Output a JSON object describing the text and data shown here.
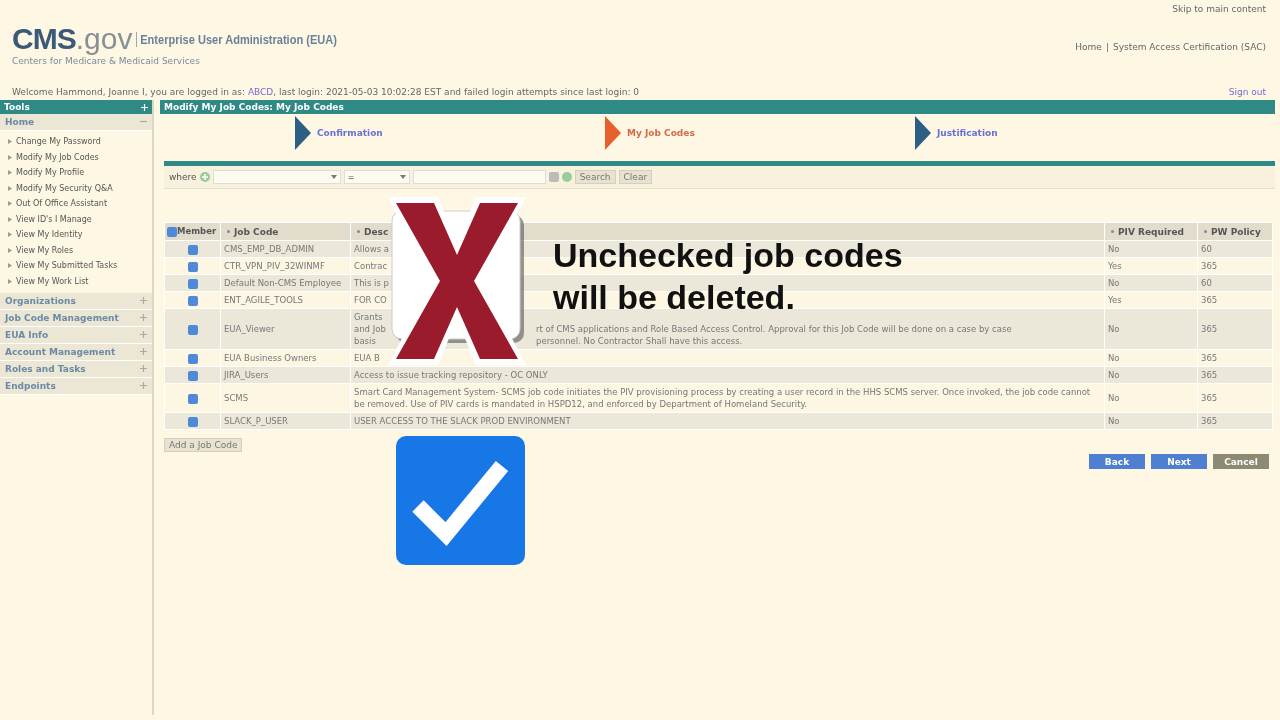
{
  "header": {
    "skip_link": "Skip to main content",
    "logo_main": "CMS",
    "logo_suffix": ".gov",
    "app_title": "Enterprise User Administration (EUA)",
    "subtitle": "Centers for Medicare & Medicaid Services",
    "nav": [
      "Home",
      "|",
      "System Access Certification (SAC)"
    ]
  },
  "welcome": {
    "before": "Welcome Hammond, Joanne I, you are logged in as:",
    "user_id": "ABCD",
    "after": ", last login: 2021-05-03 10:02:28 EST and failed login attempts since last login: 0",
    "sign_out": "Sign out"
  },
  "sidebar": {
    "title": "Tools",
    "sections": [
      {
        "label": "Home",
        "expanded": true,
        "items": [
          "Change My Password",
          "Modify My Job Codes",
          "Modify My Profile",
          "Modify My Security Q&A",
          "Out Of Office Assistant",
          "View ID's I Manage",
          "View My Identity",
          "View My Roles",
          "View My Submitted Tasks",
          "View My Work List"
        ]
      },
      {
        "label": "Organizations",
        "expanded": false
      },
      {
        "label": "Job Code Management",
        "expanded": false
      },
      {
        "label": "EUA Info",
        "expanded": false
      },
      {
        "label": "Account Management",
        "expanded": false
      },
      {
        "label": "Roles and Tasks",
        "expanded": false
      },
      {
        "label": "Endpoints",
        "expanded": false
      }
    ]
  },
  "page_title": "Modify My Job Codes: My Job Codes",
  "steps": [
    {
      "label": "Confirmation",
      "selected": false
    },
    {
      "label": "My Job Codes",
      "selected": true
    },
    {
      "label": "Justification",
      "selected": false
    }
  ],
  "filter": {
    "label": "where",
    "operator": "=",
    "search_button": "Search",
    "clear_button": "Clear"
  },
  "table": {
    "select_all": true,
    "columns": [
      "Member",
      "Job Code",
      "Desc",
      "PIV Required",
      "PW Policy"
    ],
    "rows": [
      {
        "member": true,
        "job_code": "CMS_EMP_DB_ADMIN",
        "lead": [
          "Allows a"
        ],
        "tail": [],
        "piv": "No",
        "pw": "60"
      },
      {
        "member": true,
        "job_code": "CTR_VPN_PIV_32WINMF",
        "lead": [
          "Contrac"
        ],
        "tail": [],
        "piv": "Yes",
        "pw": "365"
      },
      {
        "member": true,
        "job_code": "Default Non-CMS Employee",
        "lead": [
          "This is p"
        ],
        "tail": [],
        "piv": "No",
        "pw": "60"
      },
      {
        "member": true,
        "job_code": "ENT_AGILE_TOOLS",
        "lead": [
          "FOR CO"
        ],
        "tail": [],
        "piv": "Yes",
        "pw": "365"
      },
      {
        "member": true,
        "job_code": "EUA_Viewer",
        "lead": [
          "Grants",
          "and Job",
          "basis"
        ],
        "tail": [
          "rt of CMS applications and Role Based Access Control. Approval for this Job Code will be done on a case by case",
          "personnel. No Contractor Shall have this access."
        ],
        "piv": "No",
        "pw": "365"
      },
      {
        "member": true,
        "job_code": "EUA Business Owners",
        "lead": [
          "EUA B"
        ],
        "tail": [],
        "piv": "No",
        "pw": "365"
      },
      {
        "member": true,
        "job_code": "JIRA_Users",
        "description": "Access to issue tracking repository - OC ONLY",
        "piv": "No",
        "pw": "365"
      },
      {
        "member": true,
        "job_code": "SCMS",
        "description": "Smart Card Management System- SCMS job code initiates the PIV provisioning process by creating a user record in the HHS SCMS server. Once invoked, the job code cannot be removed. Use of PIV cards is mandated in HSPD12, and enforced by Department of Homeland Security.",
        "piv": "No",
        "pw": "365"
      },
      {
        "member": true,
        "job_code": "SLACK_P_USER",
        "description": "USER ACCESS TO THE SLACK PROD ENVIRONMENT",
        "piv": "No",
        "pw": "365"
      }
    ]
  },
  "add_button": "Add a Job Code",
  "actions": [
    {
      "label": "Back",
      "kind": "primary"
    },
    {
      "label": "Next",
      "kind": "primary"
    },
    {
      "label": "Cancel",
      "kind": "secondary"
    }
  ],
  "overlay": {
    "message": "Unchecked job codes will be deleted."
  }
}
